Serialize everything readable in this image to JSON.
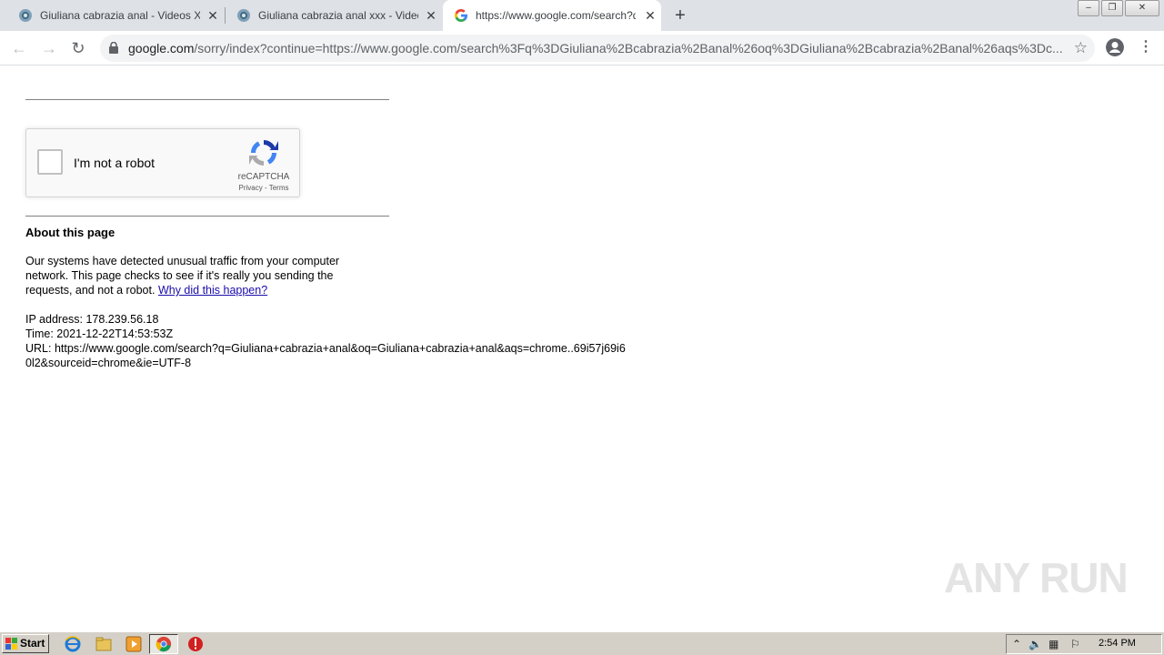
{
  "browser": {
    "tabs": [
      {
        "title": "Giuliana cabrazia anal - Videos Xxx"
      },
      {
        "title": "Giuliana cabrazia anal xxx - Videos X"
      },
      {
        "title": "https://www.google.com/search?q="
      }
    ],
    "newtab_label": "+",
    "url_host": "google.com",
    "url_path": "/sorry/index?continue=https://www.google.com/search%3Fq%3DGiuliana%2Bcabrazia%2Banal%26oq%3DGiuliana%2Bcabrazia%2Banal%26aqs%3Dc..."
  },
  "captcha": {
    "checkbox_label": "I'm not a robot",
    "brand": "reCAPTCHA",
    "privacy": "Privacy",
    "sep": " - ",
    "terms": "Terms"
  },
  "about": {
    "heading": "About this page",
    "text": "Our systems have detected unusual traffic from your computer network. This page checks to see if it's really you sending the requests, and not a robot.",
    "link": "Why did this happen?",
    "ip": "IP address: 178.239.56.18",
    "time": "Time: 2021-12-22T14:53:53Z",
    "url": "URL: https://www.google.com/search?q=Giuliana+cabrazia+anal&oq=Giuliana+cabrazia+anal&aqs=chrome..69i57j69i60l2&sourceid=chrome&ie=UTF-8"
  },
  "watermark": "ANY RUN",
  "taskbar": {
    "start": "Start",
    "clock": "2:54 PM"
  },
  "icons": [
    "globe-favicon",
    "google-favicon",
    "close-icon",
    "back-icon",
    "forward-icon",
    "reload-icon",
    "lock-icon",
    "star-icon",
    "profile-icon",
    "menu-icon",
    "recaptcha-logo",
    "ie-icon",
    "folder-icon",
    "media-icon",
    "chrome-icon",
    "stop-icon"
  ]
}
